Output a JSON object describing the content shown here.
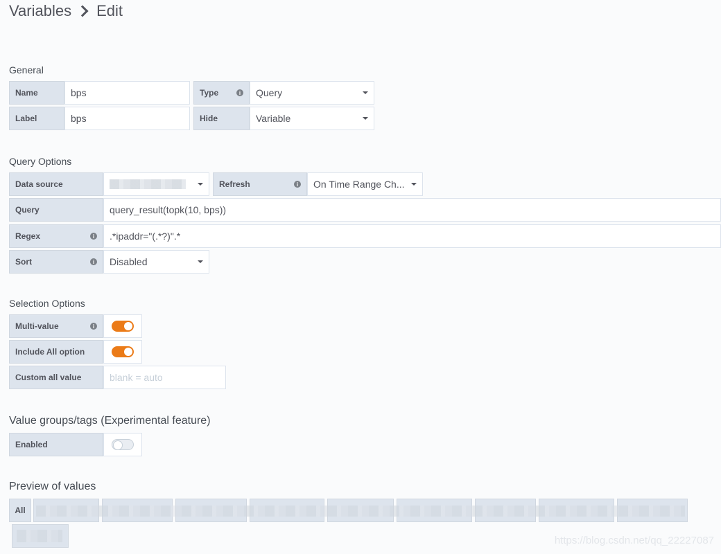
{
  "breadcrumb": {
    "parent": "Variables",
    "current": "Edit"
  },
  "general": {
    "title": "General",
    "name_label": "Name",
    "name_value": "bps",
    "label_label": "Label",
    "label_value": "bps",
    "type_label": "Type",
    "type_value": "Query",
    "hide_label": "Hide",
    "hide_value": "Variable"
  },
  "query_options": {
    "title": "Query Options",
    "datasource_label": "Data source",
    "refresh_label": "Refresh",
    "refresh_value": "On Time Range Ch...",
    "query_label": "Query",
    "query_value": "query_result(topk(10, bps))",
    "regex_label": "Regex",
    "regex_value": ".*ipaddr=\"(.*?)\".*",
    "sort_label": "Sort",
    "sort_value": "Disabled"
  },
  "selection_options": {
    "title": "Selection Options",
    "multi_value_label": "Multi-value",
    "multi_value_on": true,
    "include_all_label": "Include All option",
    "include_all_on": true,
    "custom_all_label": "Custom all value",
    "custom_all_placeholder": "blank = auto"
  },
  "value_groups": {
    "title": "Value groups/tags (Experimental feature)",
    "enabled_label": "Enabled",
    "enabled_on": false
  },
  "preview": {
    "title": "Preview of values",
    "all_label": "All"
  },
  "watermark": "https://blog.csdn.net/qq_22227087",
  "colors": {
    "accent": "#eb7b18",
    "label_bg": "#dde4ed",
    "page_bg": "#fafbfc"
  }
}
